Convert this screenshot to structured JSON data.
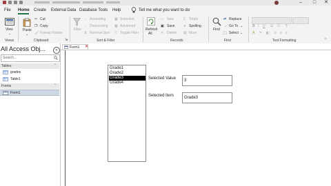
{
  "menu": {
    "items": [
      "File",
      "Home",
      "Create",
      "External Data",
      "Database Tools",
      "Help"
    ],
    "tell_me": "Tell me what you want to do"
  },
  "ribbon": {
    "views": {
      "view": "View",
      "group": "Views"
    },
    "clipboard": {
      "paste": "Paste",
      "cut": "Cut",
      "copy": "Copy",
      "format_painter": "Format Painter",
      "group": "Clipboard"
    },
    "sort_filter": {
      "filter": "Filter",
      "ascending": "Ascending",
      "descending": "Descending",
      "remove_sort": "Remove Sort",
      "selection": "Selection",
      "advanced": "Advanced",
      "toggle_filter": "Toggle Filter",
      "group": "Sort & Filter"
    },
    "records": {
      "refresh": "Refresh",
      "refresh_all": "All",
      "new": "New",
      "save": "Save",
      "delete": "Delete",
      "totals": "Totals",
      "spelling": "Spelling",
      "more": "More",
      "group": "Records"
    },
    "find": {
      "find": "Find",
      "replace": "Replace",
      "goto": "Go To",
      "select": "Select",
      "group": "Find"
    },
    "text_formatting": {
      "group": "Text Formatting"
    }
  },
  "nav": {
    "title": "All Access Obj...",
    "search_placeholder": "Search...",
    "sections": [
      {
        "label": "Tables",
        "items": [
          "grades",
          "Table1"
        ]
      },
      {
        "label": "Forms",
        "items": [
          "Form1"
        ]
      }
    ]
  },
  "document": {
    "tab": "Form1",
    "listbox": {
      "items": [
        "Grade1",
        "Grade2",
        "Grade3",
        "Grade4"
      ],
      "selected_index": 2
    },
    "selected_value": {
      "label": "Selected Value",
      "value": "3"
    },
    "selected_item": {
      "label": "Selected Item",
      "value": "Grade3"
    }
  }
}
